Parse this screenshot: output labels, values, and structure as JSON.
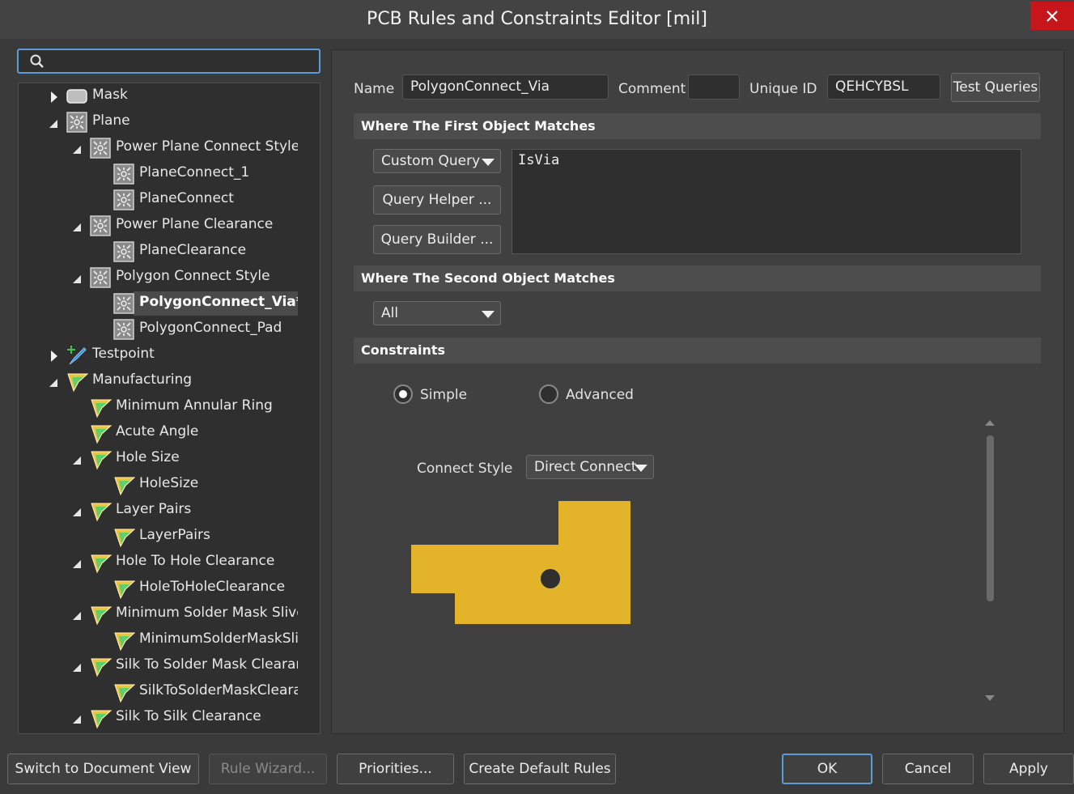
{
  "window": {
    "title": "PCB Rules and Constraints Editor [mil]",
    "close_icon": "close-icon"
  },
  "search": {
    "placeholder": "",
    "value": ""
  },
  "tree": {
    "items": [
      {
        "label": "Mask",
        "depth": 0,
        "state": "collapsed",
        "icon": "mask-icon"
      },
      {
        "label": "Plane",
        "depth": 0,
        "state": "expanded",
        "icon": "plane-icon"
      },
      {
        "label": "Power Plane Connect Style",
        "depth": 1,
        "state": "expanded",
        "icon": "plane-icon"
      },
      {
        "label": "PlaneConnect_1",
        "depth": 2,
        "state": "leaf",
        "icon": "plane-icon"
      },
      {
        "label": "PlaneConnect",
        "depth": 2,
        "state": "leaf",
        "icon": "plane-icon"
      },
      {
        "label": "Power Plane Clearance",
        "depth": 1,
        "state": "expanded",
        "icon": "plane-icon"
      },
      {
        "label": "PlaneClearance",
        "depth": 2,
        "state": "leaf",
        "icon": "plane-icon"
      },
      {
        "label": "Polygon Connect Style",
        "depth": 1,
        "state": "expanded",
        "icon": "plane-icon"
      },
      {
        "label": "PolygonConnect_Via*",
        "depth": 2,
        "state": "leaf",
        "icon": "plane-icon",
        "selected": true
      },
      {
        "label": "PolygonConnect_Pad",
        "depth": 2,
        "state": "leaf",
        "icon": "plane-icon"
      },
      {
        "label": "Testpoint",
        "depth": 0,
        "state": "collapsed",
        "icon": "testpoint-icon"
      },
      {
        "label": "Manufacturing",
        "depth": 0,
        "state": "expanded",
        "icon": "manufacturing-icon"
      },
      {
        "label": "Minimum Annular Ring",
        "depth": 1,
        "state": "leaf",
        "icon": "manufacturing-icon"
      },
      {
        "label": "Acute Angle",
        "depth": 1,
        "state": "leaf",
        "icon": "manufacturing-icon"
      },
      {
        "label": "Hole Size",
        "depth": 1,
        "state": "expanded",
        "icon": "manufacturing-icon"
      },
      {
        "label": "HoleSize",
        "depth": 2,
        "state": "leaf",
        "icon": "manufacturing-icon"
      },
      {
        "label": "Layer Pairs",
        "depth": 1,
        "state": "expanded",
        "icon": "manufacturing-icon"
      },
      {
        "label": "LayerPairs",
        "depth": 2,
        "state": "leaf",
        "icon": "manufacturing-icon"
      },
      {
        "label": "Hole To Hole Clearance",
        "depth": 1,
        "state": "expanded",
        "icon": "manufacturing-icon"
      },
      {
        "label": "HoleToHoleClearance",
        "depth": 2,
        "state": "leaf",
        "icon": "manufacturing-icon"
      },
      {
        "label": "Minimum Solder Mask Sliver",
        "depth": 1,
        "state": "expanded",
        "icon": "manufacturing-icon"
      },
      {
        "label": "MinimumSolderMaskSlive",
        "depth": 2,
        "state": "leaf",
        "icon": "manufacturing-icon"
      },
      {
        "label": "Silk To Solder Mask Clearance",
        "depth": 1,
        "state": "expanded",
        "icon": "manufacturing-icon"
      },
      {
        "label": "SilkToSolderMaskClearanc",
        "depth": 2,
        "state": "leaf",
        "icon": "manufacturing-icon"
      },
      {
        "label": "Silk To Silk Clearance",
        "depth": 1,
        "state": "expanded",
        "icon": "manufacturing-icon"
      }
    ]
  },
  "rule": {
    "name_label": "Name",
    "name_value": "PolygonConnect_Via",
    "comment_label": "Comment",
    "comment_value": "",
    "uid_label": "Unique ID",
    "uid_value": "QEHCYBSL",
    "test_queries": "Test Queries"
  },
  "first_match": {
    "header": "Where The First Object Matches",
    "mode": "Custom Query",
    "query_helper": "Query Helper ...",
    "query_builder": "Query Builder ...",
    "query_text": "IsVia"
  },
  "second_match": {
    "header": "Where The Second Object Matches",
    "mode": "All"
  },
  "constraints": {
    "header": "Constraints",
    "simple_label": "Simple",
    "advanced_label": "Advanced",
    "selected_mode": "Simple",
    "connect_style_label": "Connect Style",
    "connect_style_value": "Direct Connect",
    "polygon_color": "#e3b42a"
  },
  "footer": {
    "switch_view": "Switch to Document View",
    "rule_wizard": "Rule Wizard...",
    "priorities": "Priorities...",
    "create_defaults": "Create Default Rules",
    "ok": "OK",
    "cancel": "Cancel",
    "apply": "Apply"
  }
}
